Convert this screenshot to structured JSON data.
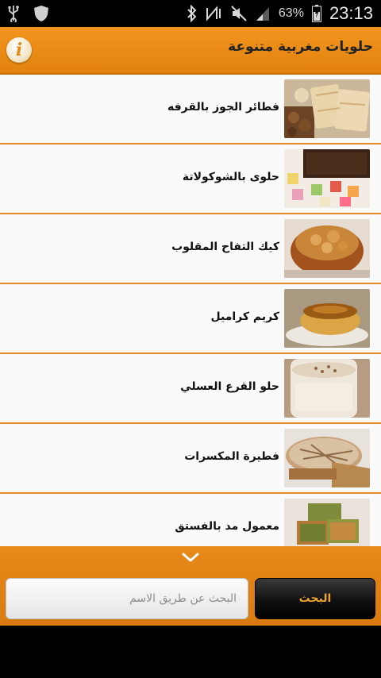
{
  "status_bar": {
    "battery_percent": "63%",
    "time": "23:13",
    "icons": [
      "usb-icon",
      "shield-icon",
      "bluetooth-icon",
      "nfc-icon",
      "mute-icon",
      "signal-icon",
      "battery-icon"
    ]
  },
  "header": {
    "title": "حلويات مغربية متنوعة",
    "info_icon": "i"
  },
  "list": {
    "items": [
      {
        "label": "فطائر الجوز بالقرفه"
      },
      {
        "label": "حلوى بالشوكولاتة"
      },
      {
        "label": "كيك التفاح المقلوب"
      },
      {
        "label": "كريم كراميل"
      },
      {
        "label": "حلو القرع العسلي"
      },
      {
        "label": "فطيرة المكسرات"
      },
      {
        "label": "معمول مد بالفستق"
      }
    ]
  },
  "search": {
    "placeholder": "البحث عن طريق الاسم",
    "button_label": "البحث"
  },
  "colors": {
    "accent": "#e8891a",
    "divider": "#e5892a",
    "button_text": "#f0a235"
  }
}
